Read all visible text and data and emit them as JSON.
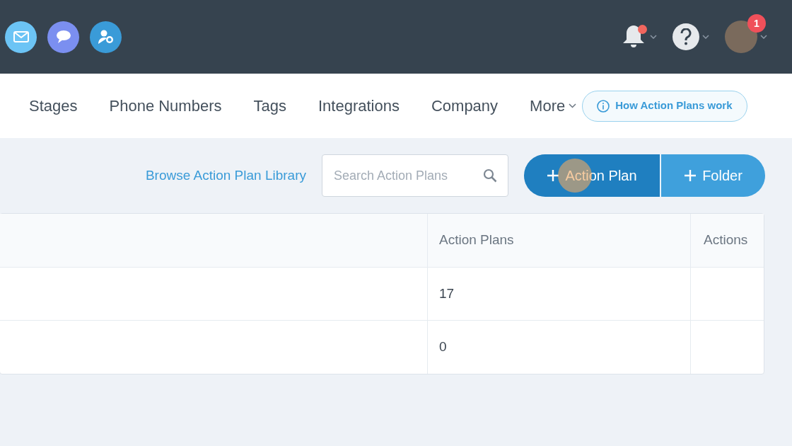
{
  "top_bar": {
    "notifications": {
      "unread": true
    },
    "profile_badge": "1"
  },
  "nav_tabs": [
    {
      "label": "Stages",
      "selected": false
    },
    {
      "label": "Phone Numbers",
      "selected": false
    },
    {
      "label": "Tags",
      "selected": false
    },
    {
      "label": "Integrations",
      "selected": false
    },
    {
      "label": "Company",
      "selected": false
    },
    {
      "label": "More",
      "selected": false,
      "dropdown": true
    }
  ],
  "help_link": "How Action Plans work",
  "toolbar": {
    "library_link": "Browse Action Plan Library",
    "search": {
      "placeholder": "Search Action Plans"
    },
    "buttons": [
      "Action Plan",
      "Folder"
    ]
  },
  "table": {
    "columns": [
      "Action Plans",
      "Actions"
    ],
    "rows": [
      {
        "action_plans": "17"
      },
      {
        "action_plans": "0"
      }
    ]
  }
}
